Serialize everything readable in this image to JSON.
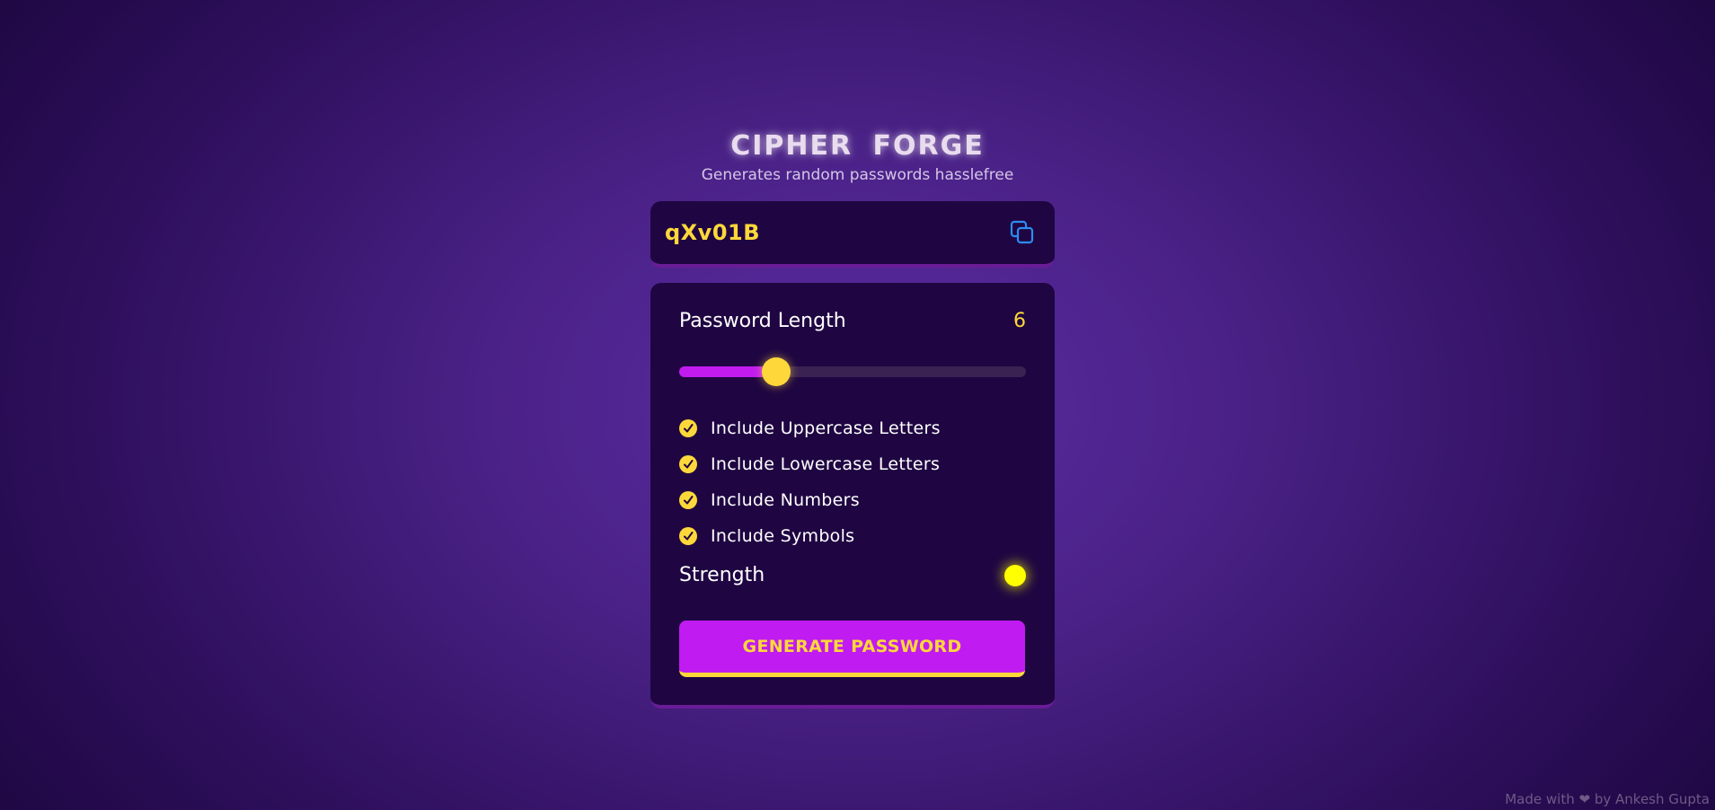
{
  "header": {
    "title": "CIPHER  FORGE",
    "subtitle": "Generates random passwords hasslefree"
  },
  "display": {
    "password": "qXv01B",
    "copy_icon": "copy-icon"
  },
  "length": {
    "label": "Password Length",
    "value": "6",
    "slider_fraction": 0.28
  },
  "options": [
    {
      "label": "Include Uppercase Letters",
      "checked": true
    },
    {
      "label": "Include Lowercase Letters",
      "checked": true
    },
    {
      "label": "Include Numbers",
      "checked": true
    },
    {
      "label": "Include Symbols",
      "checked": true
    }
  ],
  "strength": {
    "label": "Strength",
    "indicator_color": "#ffff00"
  },
  "generate": {
    "label": "GENERATE PASSWORD"
  },
  "footer": {
    "prefix": "Made with",
    "icon": "heart-icon",
    "suffix": "by Ankesh Gupta"
  },
  "colors": {
    "accent": "#c01bf1",
    "highlight": "#fed83a",
    "panel": "#1f0642"
  }
}
